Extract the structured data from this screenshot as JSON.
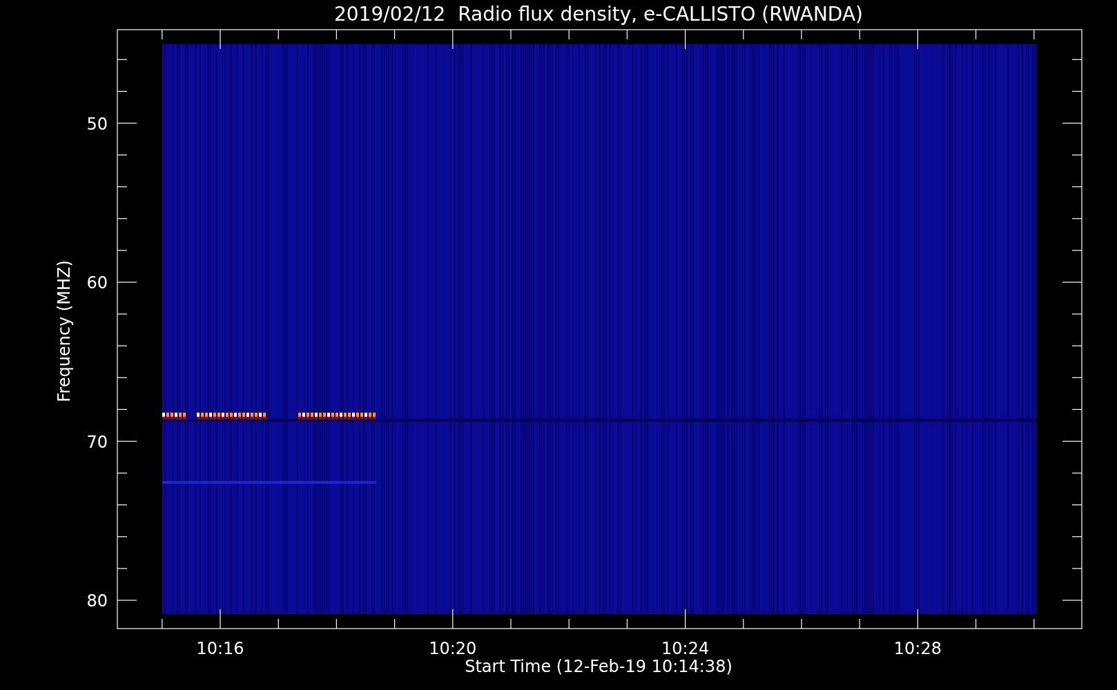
{
  "title": "2019/02/12  Radio flux density, e-CALLISTO (RWANDA)",
  "y_axis": {
    "label": "Frequency (MHZ)",
    "ticks": [
      "50",
      "60",
      "70",
      "80"
    ]
  },
  "x_axis": {
    "label": "Start Time (12-Feb-19 10:14:38)",
    "ticks": [
      "10:16",
      "10:20",
      "10:24",
      "10:28"
    ]
  }
}
